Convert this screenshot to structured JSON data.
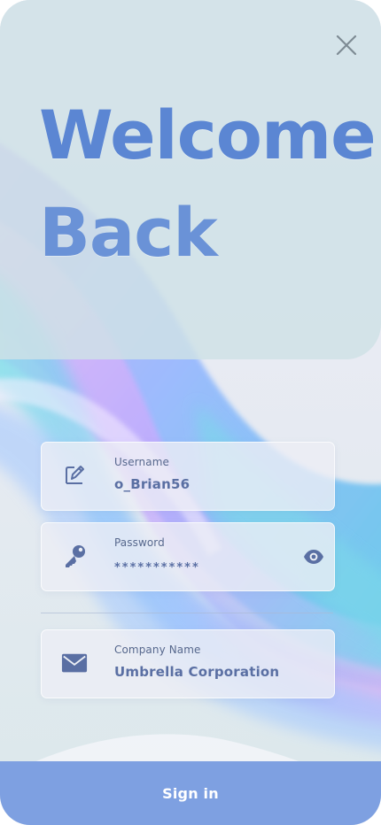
{
  "header": {
    "title_line1": "Welcome",
    "title_line2": "Back",
    "close_icon": "close-icon"
  },
  "fields": {
    "username": {
      "label": "Username",
      "value": "o_Brian56",
      "icon": "edit-icon"
    },
    "password": {
      "label": "Password",
      "value": "***********",
      "icon": "key-icon",
      "toggle_icon": "eye-icon"
    },
    "company": {
      "label": "Company Name",
      "value": "Umbrella Corporation",
      "icon": "mail-icon"
    }
  },
  "actions": {
    "sign_in_label": "Sign in"
  },
  "colors": {
    "accent": "#7ea0e1",
    "title": "#5b86d3",
    "text": "#5a6fa3",
    "label": "#57688d",
    "icon": "#5a6fa3"
  }
}
